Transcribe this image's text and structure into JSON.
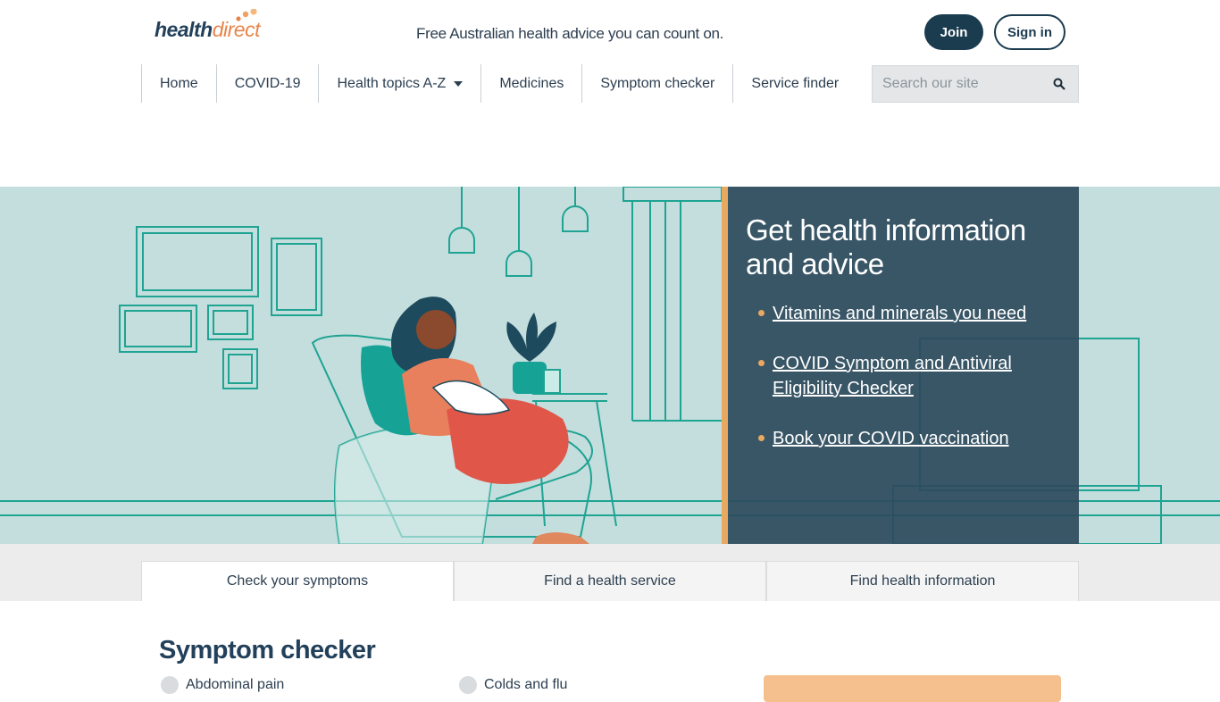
{
  "header": {
    "logo_health": "health",
    "logo_direct": "direct",
    "tagline": "Free Australian health advice you can count on.",
    "join_label": "Join",
    "signin_label": "Sign in"
  },
  "nav": {
    "items": [
      {
        "label": "Home"
      },
      {
        "label": "COVID-19"
      },
      {
        "label": "Health topics A-Z"
      },
      {
        "label": "Medicines"
      },
      {
        "label": "Symptom checker"
      },
      {
        "label": "Service finder"
      }
    ],
    "search_placeholder": "Search our site",
    "search_value": ""
  },
  "hero": {
    "title": "Get health information and advice",
    "links": [
      {
        "label": "Vitamins and minerals you need"
      },
      {
        "label": "COVID Symptom and Antiviral Eligibility Checker"
      },
      {
        "label": "Book your COVID vaccination"
      }
    ]
  },
  "tabs": [
    {
      "label": "Check your symptoms",
      "active": true
    },
    {
      "label": "Find a health service",
      "active": false
    },
    {
      "label": "Find health information",
      "active": false
    }
  ],
  "symptom_checker": {
    "title": "Symptom checker",
    "options": [
      {
        "label": "Abdominal pain"
      },
      {
        "label": "Colds and flu"
      }
    ]
  },
  "colors": {
    "brand_dark": "#1b3b4f",
    "brand_orange": "#e8854a",
    "hero_bg": "#c4dede",
    "panel_bg": "#2d4a5c",
    "accent": "#e8a860"
  },
  "icons": {
    "search": "search-icon",
    "dropdown": "caret-down-icon"
  }
}
